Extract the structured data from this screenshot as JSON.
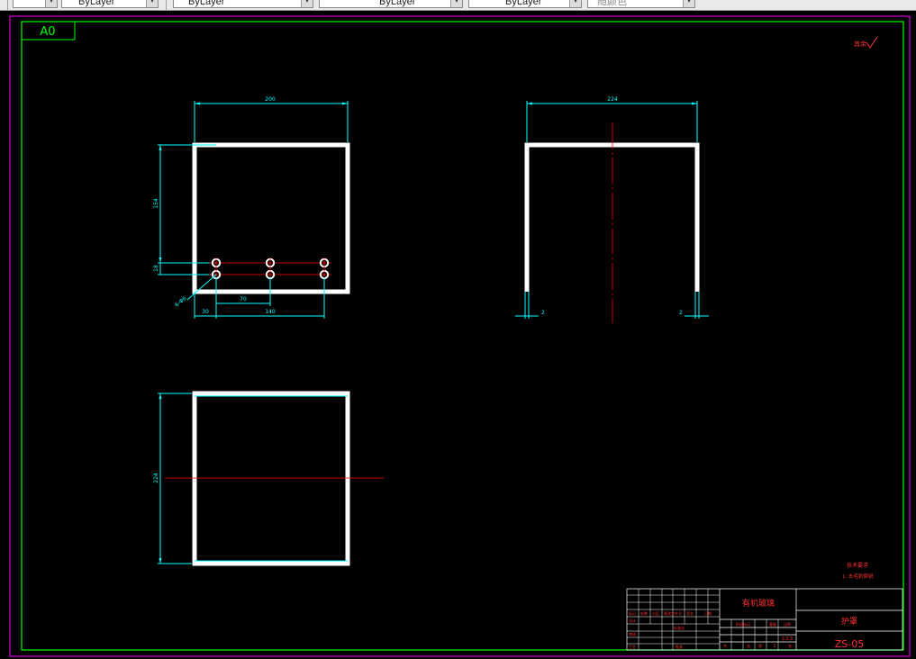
{
  "toolbar": {
    "linetype_value": "ByLayer",
    "color_value": "ByLayer",
    "lineweight_value": "ByLayer",
    "lineweight2_value": "ByLayer",
    "plotstyle_value": "随颜色",
    "layer_value": "—"
  },
  "drawing": {
    "sheet_size_label": "A0",
    "roughness_symbol": "其余",
    "front_view": {
      "width_dim": "200",
      "height_dim": "154",
      "hole_spacing_dim": "18",
      "hole_callout": "6-Φ6",
      "pitch_dim": "70",
      "offset_dim": "30",
      "span_dim": "140"
    },
    "side_view": {
      "width_dim": "224",
      "left_thk_dim": "2",
      "right_thk_dim": "2"
    },
    "top_view": {
      "depth_dim": "224"
    },
    "tech_requirements": {
      "title": "技术要求",
      "item_1": "1. 去毛刺倒锐"
    },
    "title_block": {
      "material": "有机玻璃",
      "part_name": "护罩",
      "drawing_number": "ZS-05",
      "scale": "1:2.5",
      "sheet_count": "1",
      "header_labels": [
        "标记",
        "处数",
        "分区",
        "更改文件号",
        "签名",
        "日期"
      ],
      "row_labels": [
        "设计",
        "审核",
        "工艺"
      ],
      "sub_labels": [
        "标准化",
        "批准"
      ],
      "info_labels": [
        "阶段标记",
        "重量",
        "比例"
      ],
      "page_labels": [
        "共",
        "张",
        "第",
        "张"
      ]
    }
  },
  "colors": {
    "background": "#000000",
    "border": "#ff00ff",
    "frame": "#00ff00",
    "geometry": "#ffffff",
    "dimension": "#00ffff",
    "centerline": "#ff0000",
    "text_red": "#ff3030"
  }
}
